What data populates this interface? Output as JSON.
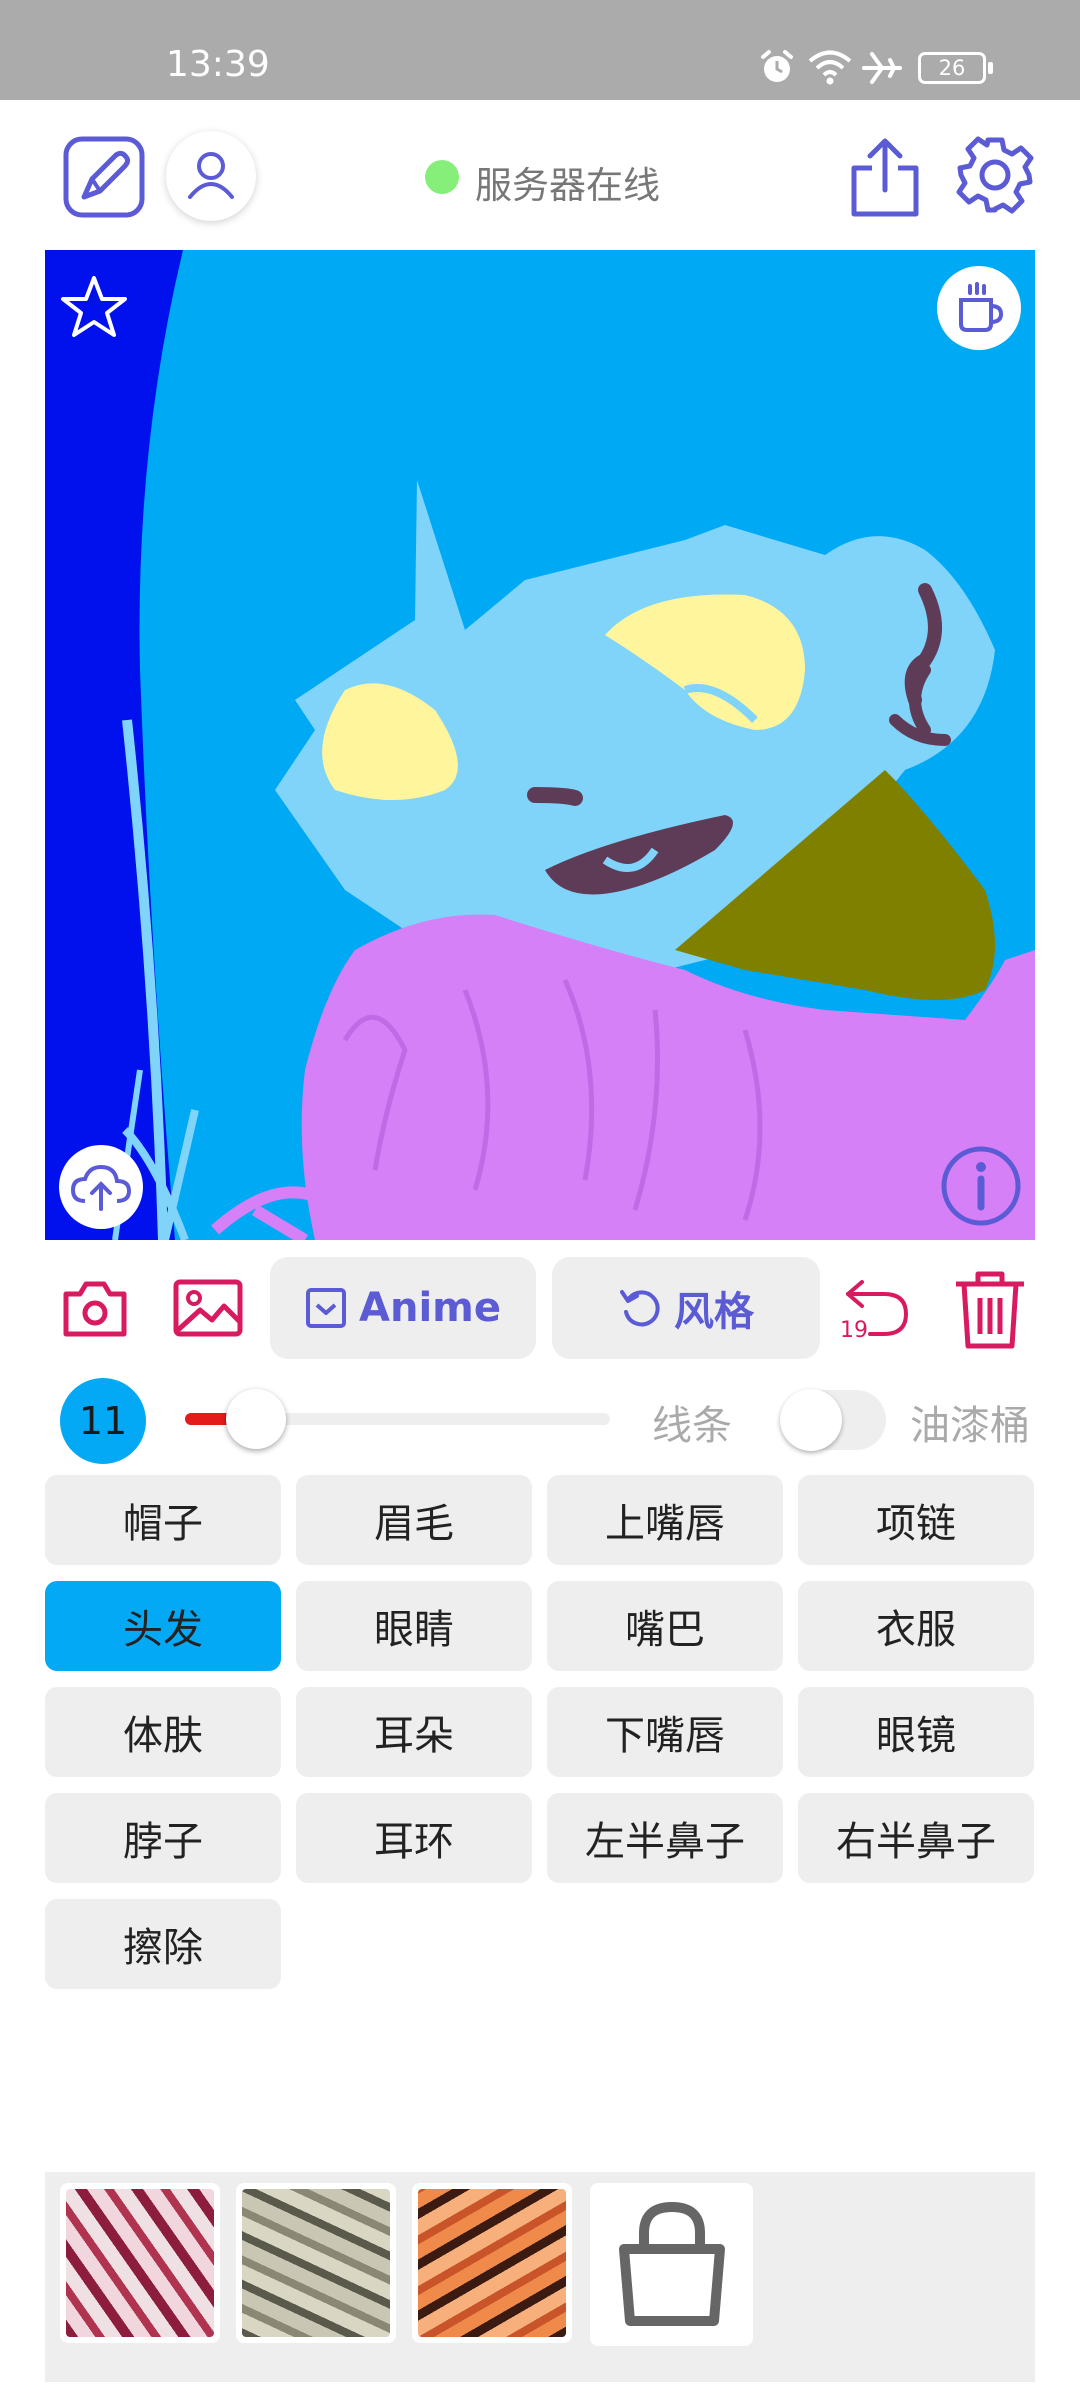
{
  "status_bar": {
    "time": "13:39",
    "battery": "26"
  },
  "header": {
    "server_status": "服务器在线"
  },
  "toolbar": {
    "anime_label": "Anime",
    "style_label": "风格",
    "undo_count": "19"
  },
  "brush": {
    "size": "11",
    "level": 0.12,
    "lines_label": "线条",
    "paint_bucket_label": "油漆桶"
  },
  "segments": [
    {
      "label": "帽子",
      "active": false
    },
    {
      "label": "眉毛",
      "active": false
    },
    {
      "label": "上嘴唇",
      "active": false
    },
    {
      "label": "项链",
      "active": false
    },
    {
      "label": "头发",
      "active": true
    },
    {
      "label": "眼睛",
      "active": false
    },
    {
      "label": "嘴巴",
      "active": false
    },
    {
      "label": "衣服",
      "active": false
    },
    {
      "label": "体肤",
      "active": false
    },
    {
      "label": "耳朵",
      "active": false
    },
    {
      "label": "下嘴唇",
      "active": false
    },
    {
      "label": "眼镜",
      "active": false
    },
    {
      "label": "脖子",
      "active": false
    },
    {
      "label": "耳环",
      "active": false
    },
    {
      "label": "左半鼻子",
      "active": false
    },
    {
      "label": "右半鼻子",
      "active": false
    },
    {
      "label": "擦除",
      "active": false
    }
  ],
  "colors": {
    "accent": "#5b5bd6",
    "danger": "#d81b60",
    "online": "#86ef7a",
    "canvas_bg": "#00a9f4",
    "hair_dark": "#0011ee",
    "skin": "#80d4fa",
    "eye": "#fff59d",
    "lips": "#5e3c58",
    "scarf": "#808000",
    "clothes": "#d580f7"
  },
  "icons": [
    "draw-icon",
    "user-icon",
    "share-icon",
    "gear-icon",
    "star-icon",
    "coffee-icon",
    "upload-cloud-icon",
    "info-icon",
    "camera-icon",
    "image-icon",
    "checkbox-icon",
    "rotate-icon",
    "undo-icon",
    "trash-icon",
    "bag-icon"
  ]
}
